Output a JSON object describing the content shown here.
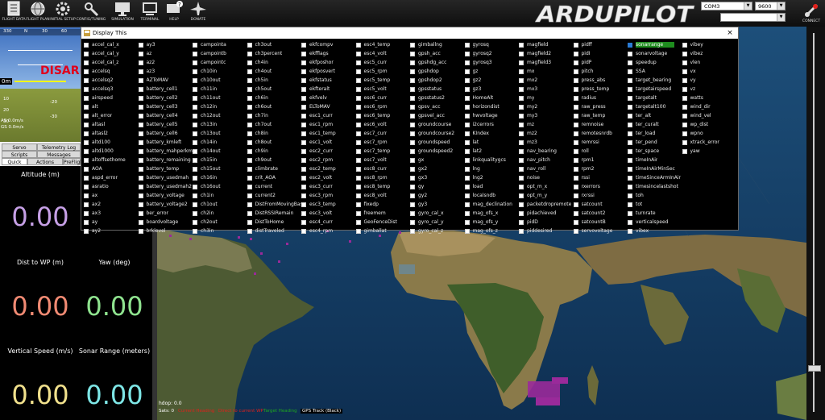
{
  "toolbar": {
    "buttons": [
      {
        "label": "FLIGHT DATA"
      },
      {
        "label": "FLIGHT PLAN"
      },
      {
        "label": "INITIAL SETUP"
      },
      {
        "label": "CONFIG/TUNING"
      },
      {
        "label": "SIMULATION"
      },
      {
        "label": "TERMINAL"
      },
      {
        "label": "HELP"
      },
      {
        "label": "DONATE"
      }
    ],
    "logo": "ARDUPILOT",
    "port": "COM3",
    "baud": "9600",
    "connect": "CONNECT"
  },
  "hud": {
    "disarmed": "DISARM",
    "alt": "0m",
    "scale": [
      "-10",
      "-20",
      "-30",
      "-40",
      "-50",
      "-60",
      "10",
      "20",
      "30",
      "40"
    ],
    "heading": [
      "330",
      "N",
      "30",
      "60"
    ],
    "status1": "AS 0.0m/s",
    "status2": "GS 0.0m/s"
  },
  "tabs": {
    "row1": [
      "Servo",
      "Telemetry Log"
    ],
    "row2": [
      "Scripts",
      "Messages"
    ],
    "row3": [
      "Quick",
      "Actions",
      "PreFlight"
    ]
  },
  "quick": {
    "items": [
      {
        "label": "Altitude (m)",
        "value": "0.00",
        "color": "#c6a0e6"
      },
      {
        "label": "Dist to WP (m)",
        "value": "0.00",
        "color": "#f08a73"
      },
      {
        "label": "Yaw (deg)",
        "value": "0.00",
        "color": "#8fe38f"
      },
      {
        "label": "Vertical Speed (m/s)",
        "value": "0.00",
        "color": "#f0e08c"
      },
      {
        "label": "Sonar Range (meters)",
        "value": "0.00",
        "color": "#7ee6e6"
      }
    ]
  },
  "dialog": {
    "title": "Display This",
    "close": "×",
    "selected": "sonarrange",
    "columns": [
      [
        "accel_cal_x",
        "accel_cal_y",
        "accel_cal_z",
        "accelsq",
        "accelsq2",
        "accelsq3",
        "airspeed",
        "alt",
        "alt_error",
        "altasl",
        "altasl2",
        "altd100",
        "altd1000",
        "altoffsethome",
        "AOA",
        "aspd_error",
        "asratio",
        "ax",
        "ax2",
        "ax3",
        "ay",
        "ay2"
      ],
      [
        "ay3",
        "az",
        "az2",
        "az3",
        "AZToMAV",
        "battery_cell1",
        "battery_cell2",
        "battery_cell3",
        "battery_cell4",
        "battery_cell5",
        "battery_cell6",
        "battery_kmleft",
        "battery_mahperkm",
        "battery_remaining",
        "battery_temp",
        "battery_usedmah",
        "battery_usedmah2",
        "battery_voltage",
        "battery_voltage2",
        "ber_error",
        "boardvoltage",
        "brklevel"
      ],
      [
        "campointa",
        "campointb",
        "campointc",
        "ch10in",
        "ch10out",
        "ch11in",
        "ch11out",
        "ch12in",
        "ch12out",
        "ch13in",
        "ch13out",
        "ch14in",
        "ch14out",
        "ch15in",
        "ch15out",
        "ch16in",
        "ch16out",
        "ch1in",
        "ch1out",
        "ch2in",
        "ch2out",
        "ch3in"
      ],
      [
        "ch3out",
        "ch3percent",
        "ch4in",
        "ch4out",
        "ch5in",
        "ch5out",
        "ch6in",
        "ch6out",
        "ch7in",
        "ch7out",
        "ch8in",
        "ch8out",
        "ch9in",
        "ch9out",
        "climbrate",
        "crit_AOA",
        "current",
        "current2",
        "DistFromMovingBase",
        "DistRSSIRemain",
        "DistToHome",
        "distTraveled"
      ],
      [
        "ekfcompv",
        "ekfflags",
        "ekfposhor",
        "ekfposvert",
        "ekfstatus",
        "ekfteralt",
        "ekfvelv",
        "ELToMAV",
        "esc1_curr",
        "esc1_rpm",
        "esc1_temp",
        "esc1_volt",
        "esc2_curr",
        "esc2_rpm",
        "esc2_temp",
        "esc2_volt",
        "esc3_curr",
        "esc3_rpm",
        "esc3_temp",
        "esc3_volt",
        "esc4_curr",
        "esc4_rpm"
      ],
      [
        "esc4_temp",
        "esc4_volt",
        "esc5_curr",
        "esc5_rpm",
        "esc5_temp",
        "esc5_volt",
        "esc6_curr",
        "esc6_rpm",
        "esc6_temp",
        "esc6_volt",
        "esc7_curr",
        "esc7_rpm",
        "esc7_temp",
        "esc7_volt",
        "esc8_curr",
        "esc8_rpm",
        "esc8_temp",
        "esc8_volt",
        "fixedp",
        "freemem",
        "GeoFenceDist",
        "gimballat"
      ],
      [
        "gimballng",
        "gpsh_acc",
        "gpshdg_acc",
        "gpshdop",
        "gpshdop2",
        "gpsstatus",
        "gpsstatus2",
        "gpsv_acc",
        "gpsvel_acc",
        "groundcourse",
        "groundcourse2",
        "groundspeed",
        "groundspeed2",
        "gx",
        "gx2",
        "gx3",
        "gy",
        "gy2",
        "gy3",
        "gyro_cal_x",
        "gyro_cal_y",
        "gyro_cal_z"
      ],
      [
        "gyrosq",
        "gyrosq2",
        "gyrosq3",
        "gz",
        "gz2",
        "gz3",
        "HomeAlt",
        "horizondist",
        "hwvoltage",
        "i2cerrors",
        "KIndex",
        "lat",
        "lat2",
        "linkqualitygcs",
        "lng",
        "lng2",
        "load",
        "localsndb",
        "mag_declination",
        "mag_ofs_x",
        "mag_ofs_y",
        "mag_ofs_z"
      ],
      [
        "magfield",
        "magfield2",
        "magfield3",
        "mx",
        "mx2",
        "mx3",
        "my",
        "my2",
        "my3",
        "mz",
        "mz2",
        "mz3",
        "nav_bearing",
        "nav_pitch",
        "nav_roll",
        "noise",
        "opt_m_x",
        "opt_m_y",
        "packetdropremote",
        "pidachieved",
        "pidD",
        "piddesired"
      ],
      [
        "pidff",
        "pidI",
        "pidP",
        "pitch",
        "press_abs",
        "press_temp",
        "radius",
        "raw_press",
        "raw_temp",
        "remnoise",
        "remotesnrdb",
        "remrssi",
        "roll",
        "rpm1",
        "rpm2",
        "rssi",
        "rxerrors",
        "rxrssi",
        "satcount",
        "satcount2",
        "satcountB",
        "servovoltage"
      ],
      [
        "sonarrange",
        "sonarvoltage",
        "speedup",
        "SSA",
        "target_bearing",
        "targetairspeed",
        "targetalt",
        "targetalt100",
        "ter_alt",
        "ter_curalt",
        "ter_load",
        "ter_pend",
        "ter_space",
        "timeInAir",
        "timeInAirMinSec",
        "timeSinceArmInAir",
        "timesincelastshot",
        "toh",
        "tot",
        "turnrate",
        "verticalspeed",
        "vibex"
      ],
      [
        "vibey",
        "vibez",
        "vlen",
        "vx",
        "vy",
        "vz",
        "watts",
        "wind_dir",
        "wind_vel",
        "wp_dist",
        "wpno",
        "xtrack_error",
        "yaw"
      ]
    ]
  },
  "map_status": {
    "hdop": "hdop: 0.0",
    "sats": "Sats: 0",
    "legend": [
      "Current Heading",
      "Direct to current WP",
      "Target Heading",
      "GPS Track (Black)"
    ],
    "legend_colors": [
      "#e0201b",
      "#e0201b",
      "#1ea81e",
      "#000000"
    ]
  },
  "colors": {
    "accent_green": "#1e8c1e",
    "checkbox_blue": "#2a7bd4"
  }
}
